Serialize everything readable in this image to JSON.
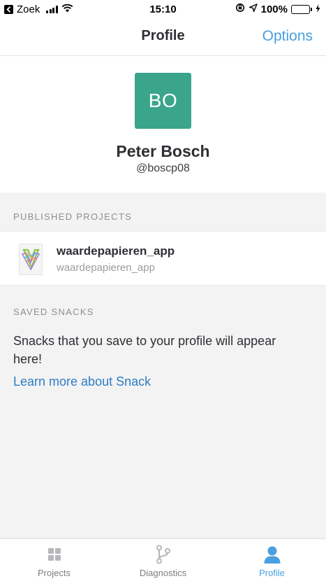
{
  "status_bar": {
    "back_app": "Zoek",
    "time": "15:10",
    "battery": "100%"
  },
  "nav": {
    "title": "Profile",
    "options": "Options"
  },
  "profile": {
    "initials": "BO",
    "name": "Peter Bosch",
    "username": "@boscp08",
    "avatar_color": "#3aa58b"
  },
  "published": {
    "header": "PUBLISHED PROJECTS",
    "items": [
      {
        "title": "waardepapieren_app",
        "subtitle": "waardepapieren_app"
      }
    ]
  },
  "saved": {
    "header": "SAVED SNACKS",
    "empty_text": "Snacks that you save to your profile will appear here!",
    "link": "Learn more about Snack"
  },
  "tabs": [
    {
      "label": "Projects",
      "icon": "grid-icon",
      "active": false
    },
    {
      "label": "Diagnostics",
      "icon": "git-branch-icon",
      "active": false
    },
    {
      "label": "Profile",
      "icon": "person-icon",
      "active": true
    }
  ],
  "colors": {
    "accent": "#4a9fe0",
    "link": "#2f7cc2",
    "battery": "#4cd964"
  }
}
